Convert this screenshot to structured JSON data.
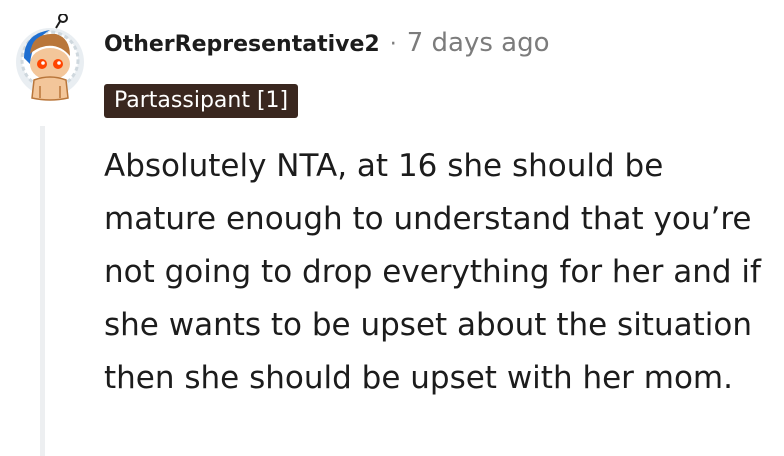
{
  "comment": {
    "author": "OtherRepresentative2",
    "separator": "·",
    "timestamp": "7 days ago",
    "flair": "Partassipant [1]",
    "body": "Absolutely NTA, at 16 she should be mature enough to understand that you’re not going to drop everything for her and if she wants to be upset about the situation then she should be upset with her mom."
  },
  "icons": {
    "avatar": "snoo-avatar-icon"
  },
  "colors": {
    "flair_background": "#3a271f",
    "flair_text": "#ffffff",
    "meta_text": "#7c7c7c",
    "thread_line": "#edeff1"
  }
}
